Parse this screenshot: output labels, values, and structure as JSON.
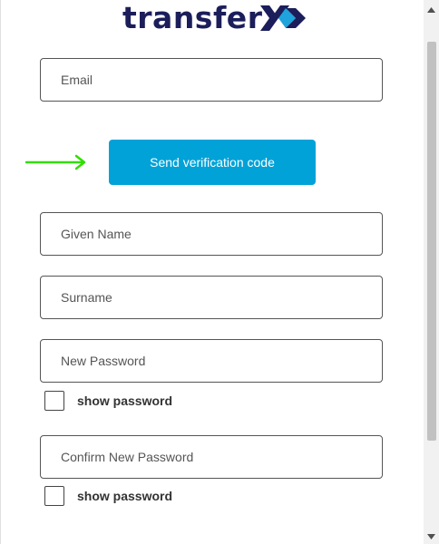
{
  "brand": {
    "name": "transfer",
    "accent": "#00a2d8",
    "dark": "#1b1e5a",
    "annotation_color": "#33dd00"
  },
  "form": {
    "email_placeholder": "Email",
    "send_code_label": "Send verification code",
    "given_name_placeholder": "Given Name",
    "surname_placeholder": "Surname",
    "new_password_placeholder": "New Password",
    "confirm_password_placeholder": "Confirm New Password",
    "show_password_label": "show password"
  },
  "icons": {
    "annotation": "arrow-right-icon",
    "scroll_up": "chevron-up-icon",
    "scroll_down": "chevron-down-icon"
  }
}
